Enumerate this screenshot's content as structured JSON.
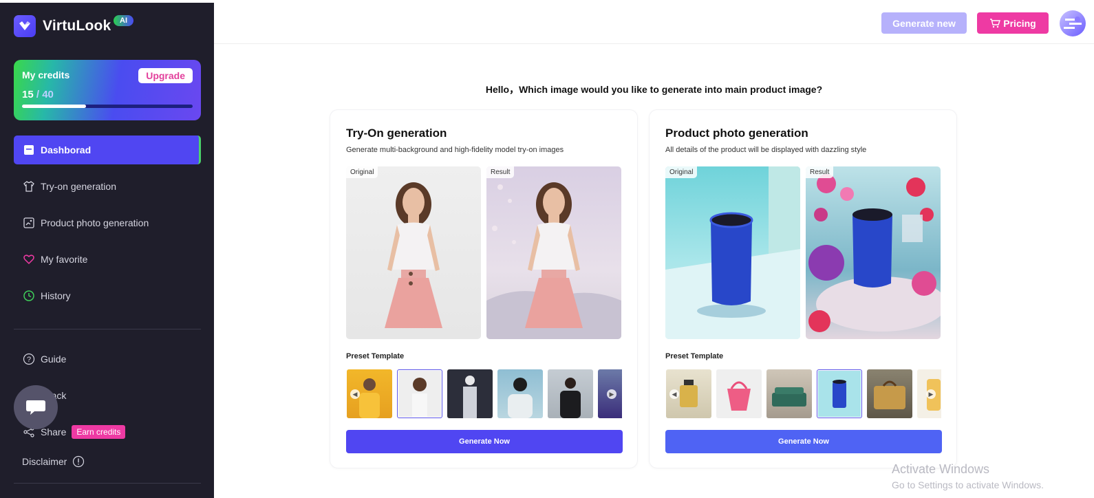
{
  "app": {
    "name": "VirtuLook",
    "badge": "AI"
  },
  "credits": {
    "title": "My credits",
    "used": "15",
    "total": " / 40",
    "upgrade_label": "Upgrade",
    "progress": 0.375
  },
  "nav": {
    "items": [
      {
        "label": "Dashborad",
        "icon": "dashboard-icon"
      },
      {
        "label": "Try-on generation",
        "icon": "shirt-icon"
      },
      {
        "label": "Product photo generation",
        "icon": "photo-icon"
      },
      {
        "label": "My favorite",
        "icon": "heart-icon"
      },
      {
        "label": "History",
        "icon": "clock-icon"
      }
    ],
    "secondary": [
      {
        "label": "Guide",
        "icon": "question-icon"
      },
      {
        "label": "dback",
        "icon": "chat-icon"
      },
      {
        "label": "Share",
        "icon": "share-icon",
        "badge": "Earn credits"
      },
      {
        "label": "Disclaimer",
        "icon": "exclamation-icon"
      }
    ]
  },
  "topbar": {
    "generate_new": "Generate new",
    "pricing": "Pricing"
  },
  "greeting": "Hello，Which image would you like to generate into main product image?",
  "cards": [
    {
      "title": "Try-On generation",
      "description": "Generate multi-background and high-fidelity model try-on images",
      "original_tag": "Original",
      "result_tag": "Result",
      "preset_label": "Preset Template",
      "button": "Generate Now"
    },
    {
      "title": "Product photo generation",
      "description": "All details of the product will be displayed with dazzling style",
      "original_tag": "Original",
      "result_tag": "Result",
      "preset_label": "Preset Template",
      "button": "Generate Now"
    }
  ],
  "watermark": {
    "line1": "Activate Windows",
    "line2": "Go to Settings to activate Windows."
  },
  "colors": {
    "accent": "#5046f2",
    "pink": "#ee3aa3",
    "sidebar": "#1f1e2b"
  }
}
